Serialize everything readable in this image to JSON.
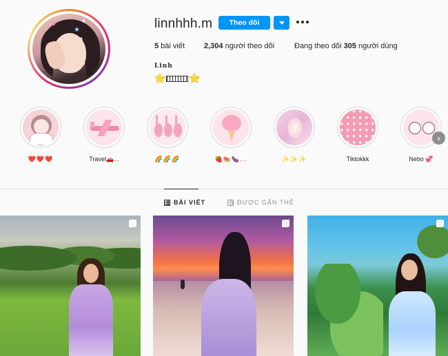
{
  "profile": {
    "username": "linnhhh.m",
    "follow_label": "Theo dõi",
    "stats": {
      "posts_count": "5",
      "posts_label": "bài viết",
      "followers_count": "2,304",
      "followers_label": "người theo dõi",
      "following_prefix": "Đang theo dõi",
      "following_count": "305",
      "following_suffix": "người dùng"
    },
    "full_name": "Linh",
    "bio_emoji": "⭐",
    "bio_box_text": "LINH"
  },
  "highlights": [
    {
      "label": "❤️❤️❤️",
      "icon": "anime-girl-sticker-icon"
    },
    {
      "label": "Travel🚗...",
      "icon": "airplane-icon"
    },
    {
      "label": "🌈🌈🌈",
      "icon": "bunnies-icon"
    },
    {
      "label": "🍓🍉🍆...",
      "icon": "cotton-candy-icon"
    },
    {
      "label": "✨✨✨",
      "icon": "pink-glow-icon"
    },
    {
      "label": "Tiktokkk",
      "icon": "pink-sprinkles-icon"
    },
    {
      "label": "Nebo 💞",
      "icon": "cute-couple-icon"
    }
  ],
  "tabs": {
    "posts": "BÀI VIẾT",
    "tagged": "ĐƯỢC GẮN THẺ"
  },
  "colors": {
    "accent": "#0095f6",
    "text": "#262626",
    "muted": "#8e8e8e",
    "border": "#dbdbdb",
    "background": "#fafafa"
  },
  "posts": [
    {
      "kind": "carousel",
      "scene": "girl sitting on park grass"
    },
    {
      "kind": "carousel",
      "scene": "girl at beach sunset"
    },
    {
      "kind": "carousel",
      "scene": "girl in tropical garden"
    }
  ]
}
